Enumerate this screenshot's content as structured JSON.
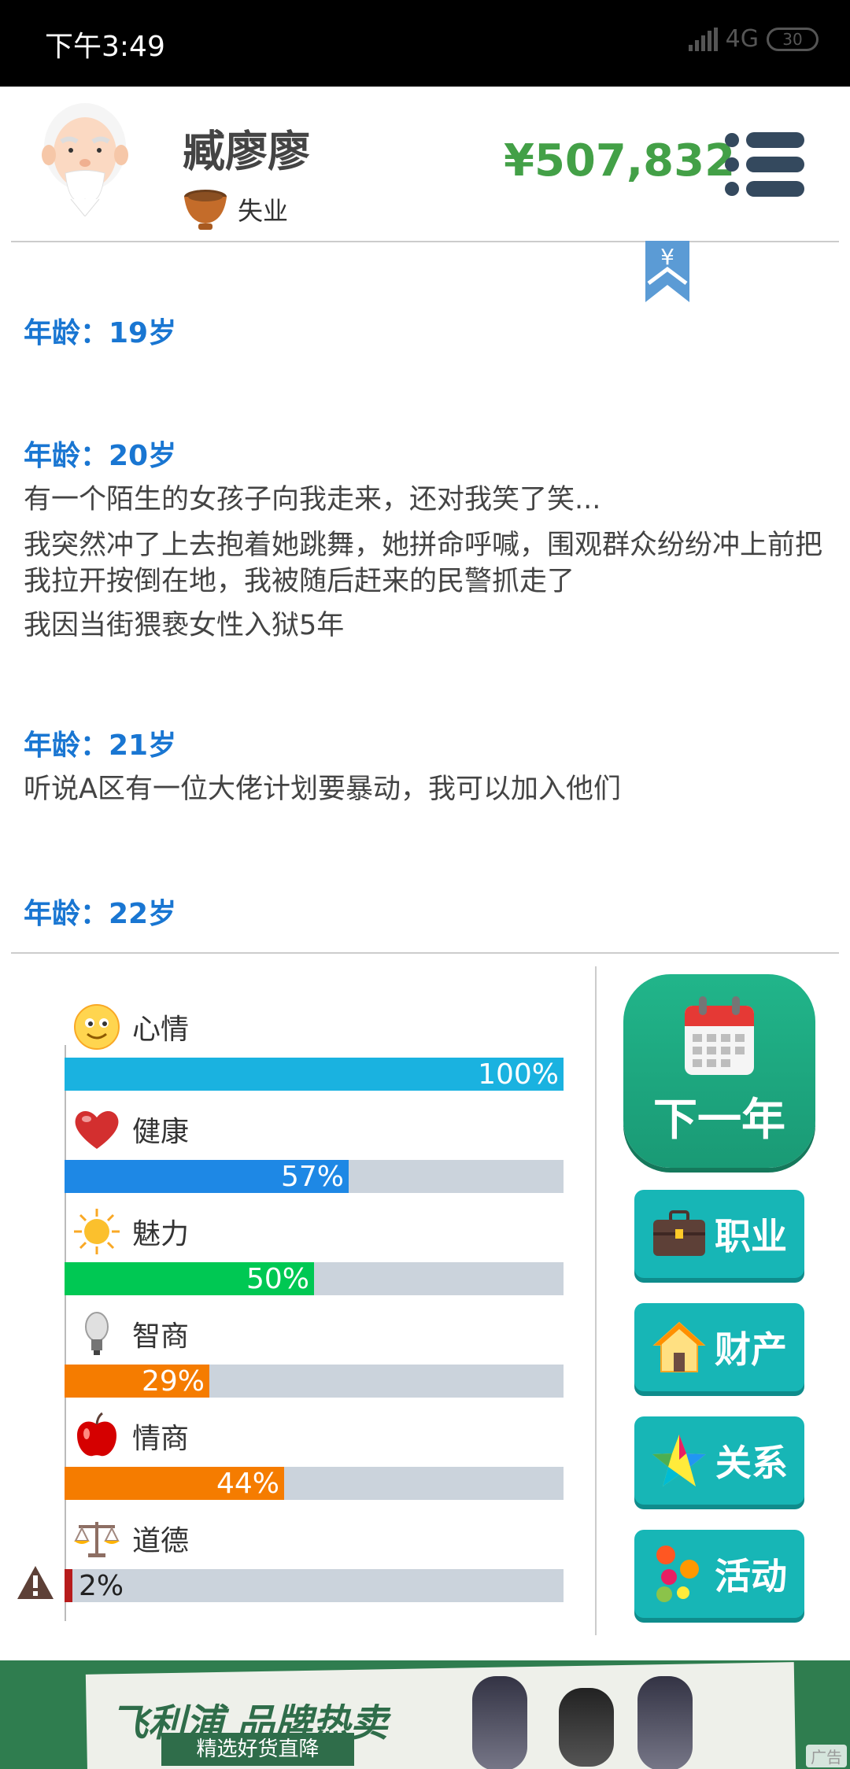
{
  "status_bar": {
    "time": "下午3:49",
    "network": "4G",
    "battery": "30"
  },
  "header": {
    "name": "臧廖廖",
    "job": "失业",
    "money": "¥507,832",
    "bookmark_symbol": "¥"
  },
  "log": [
    {
      "age": "年龄：19岁",
      "events": []
    },
    {
      "age": "年龄：20岁",
      "events": [
        "有一个陌生的女孩子向我走来，还对我笑了笑...",
        "我突然冲了上去抱着她跳舞，她拼命呼喊，围观群众纷纷冲上前把我拉开按倒在地，我被随后赶来的民警抓走了",
        "我因当街猥亵女性入狱5年"
      ]
    },
    {
      "age": "年龄：21岁",
      "events": [
        "听说A区有一位大佬计划要暴动，我可以加入他们"
      ]
    },
    {
      "age": "年龄：22岁",
      "events": []
    }
  ],
  "stats": [
    {
      "key": "mood",
      "label": "心情",
      "value": 100,
      "display": "100%",
      "color": "#1ab2e0",
      "icon": "smiley-icon"
    },
    {
      "key": "health",
      "label": "健康",
      "value": 57,
      "display": "57%",
      "color": "#1e88e5",
      "icon": "heart-icon"
    },
    {
      "key": "charm",
      "label": "魅力",
      "value": 50,
      "display": "50%",
      "color": "#00c853",
      "icon": "sun-icon"
    },
    {
      "key": "iq",
      "label": "智商",
      "value": 29,
      "display": "29%",
      "color": "#f57c00",
      "icon": "lightbulb-icon"
    },
    {
      "key": "eq",
      "label": "情商",
      "value": 44,
      "display": "44%",
      "color": "#f57c00",
      "icon": "apple-icon"
    },
    {
      "key": "morality",
      "label": "道德",
      "value": 2,
      "display": "2%",
      "color": "#b71c1c",
      "icon": "scales-icon"
    }
  ],
  "actions": {
    "next_year": "下一年",
    "career": "职业",
    "property": "财产",
    "relations": "关系",
    "activities": "活动"
  },
  "ad": {
    "title": "飞利浦 品牌热卖",
    "subtitle": "精选好货直降",
    "tag": "广告"
  }
}
